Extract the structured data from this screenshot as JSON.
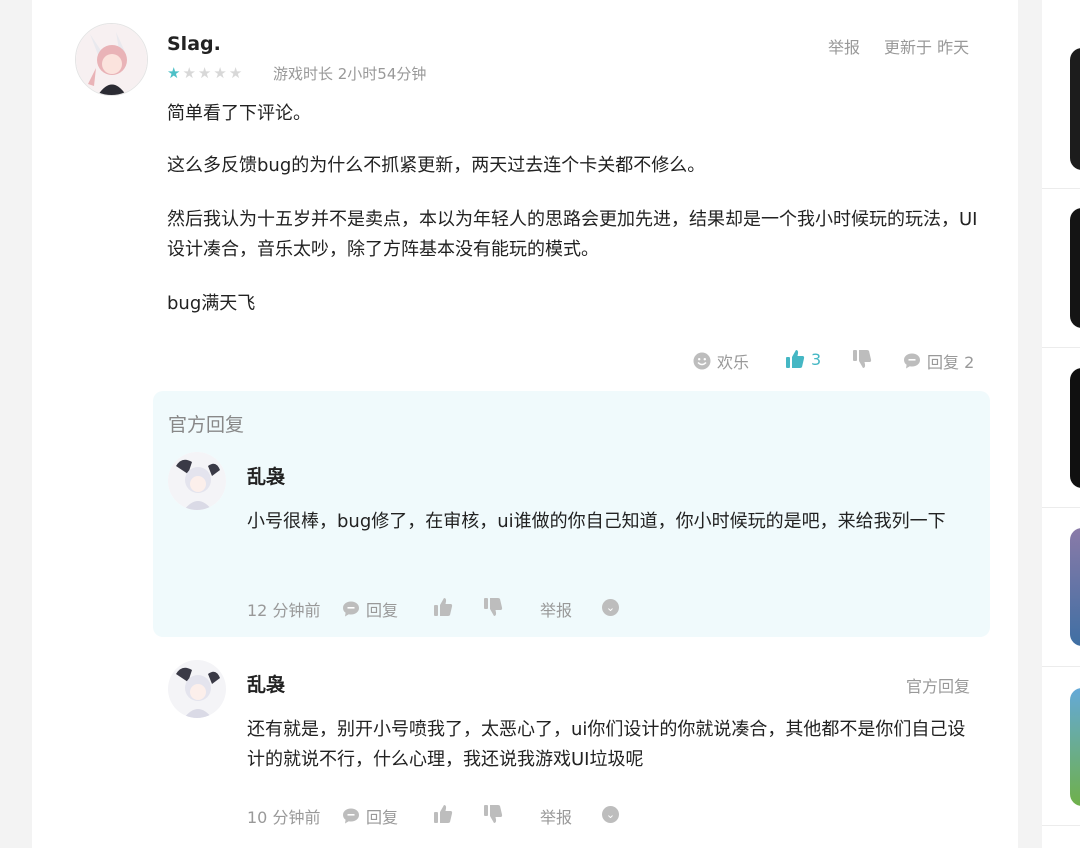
{
  "review": {
    "username": "Slag.",
    "rating": 1,
    "rating_max": 5,
    "playtime": "游戏时长 2小时54分钟",
    "report_label": "举报",
    "updated": "更新于 昨天",
    "paragraphs": [
      "简单看了下评论。",
      "这么多反馈bug的为什么不抓紧更新，两天过去连个卡关都不修么。",
      "然后我认为十五岁并不是卖点，本以为年轻人的思路会更加先进，结果却是一个我小时候玩的玩法，UI设计凑合，音乐太吵，除了方阵基本没有能玩的模式。",
      "bug满天飞"
    ],
    "actions": {
      "funny_label": "欢乐",
      "like_count": "3",
      "reply_label": "回复 2"
    }
  },
  "official_reply": {
    "section_title": "官方回复",
    "author": "乱袅",
    "text": "小号很棒，bug修了，在审核，ui谁做的你自己知道，你小时候玩的是吧，来给我列一下",
    "time": "12 分钟前",
    "reply_label": "回复",
    "report_label": "举报"
  },
  "second_reply": {
    "author": "乱袅",
    "tag": "官方回复",
    "text": "还有就是，别开小号喷我了，太恶心了，ui你们设计的你就说凑合，其他都不是你们自己设计的就说不行，什么心理，我还说我游戏UI垃圾呢",
    "time": "10 分钟前",
    "reply_label": "回复",
    "report_label": "举报"
  },
  "colors": {
    "accent": "#45b7c4",
    "muted": "#999999",
    "official_bg": "#f0fafc"
  }
}
